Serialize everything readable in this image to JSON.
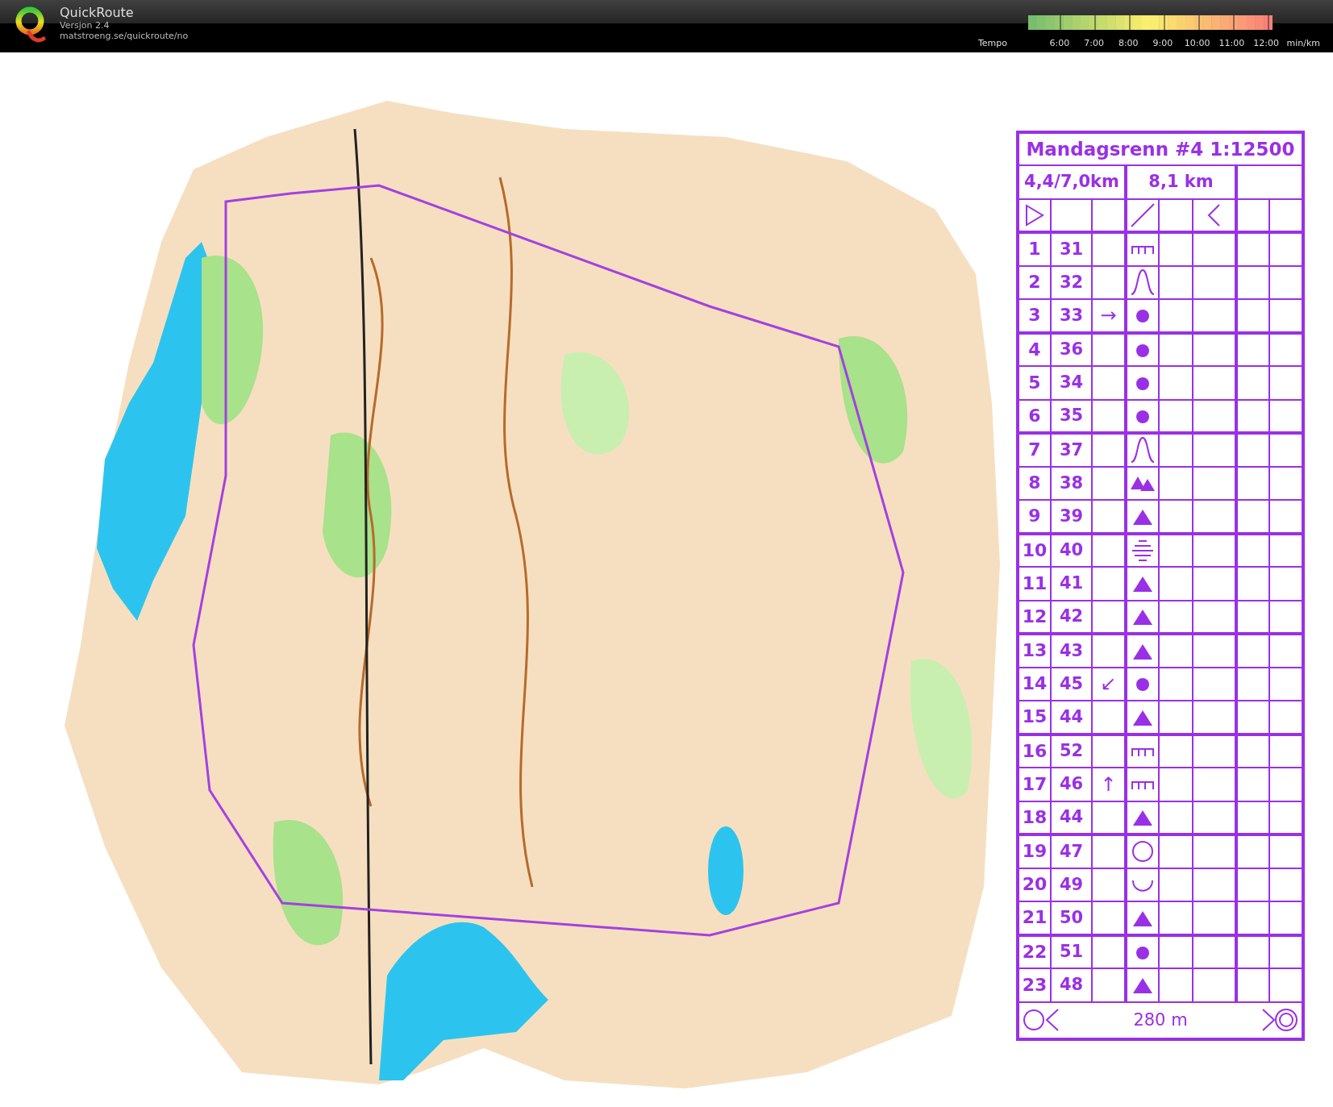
{
  "app": {
    "name": "QuickRoute",
    "version": "Versjon 2.4",
    "url": "matstroeng.se/quickroute/no"
  },
  "tempo_legend": {
    "label": "Tempo",
    "ticks": [
      "6:00",
      "7:00",
      "8:00",
      "9:00",
      "10:00",
      "11:00",
      "12:00"
    ],
    "unit": "min/km"
  },
  "control_sheet": {
    "title": "Mandagsrenn #4 1:12500",
    "climb_info": "4,4/7,0km",
    "length": "8,1 km",
    "controls": [
      {
        "number": "1",
        "code": "31",
        "kind": "cliff"
      },
      {
        "number": "2",
        "code": "32",
        "kind": "spur"
      },
      {
        "number": "3",
        "code": "33",
        "direction": "→",
        "kind": "knoll"
      },
      {
        "number": "4",
        "code": "36",
        "kind": "knoll"
      },
      {
        "number": "5",
        "code": "34",
        "kind": "knoll"
      },
      {
        "number": "6",
        "code": "35",
        "kind": "knoll"
      },
      {
        "number": "7",
        "code": "37",
        "kind": "spur"
      },
      {
        "number": "8",
        "code": "38",
        "kind": "cluster"
      },
      {
        "number": "9",
        "code": "39",
        "kind": "boulder"
      },
      {
        "number": "10",
        "code": "40",
        "kind": "marsh"
      },
      {
        "number": "11",
        "code": "41",
        "kind": "boulder"
      },
      {
        "number": "12",
        "code": "42",
        "kind": "boulder"
      },
      {
        "number": "13",
        "code": "43",
        "kind": "boulder"
      },
      {
        "number": "14",
        "code": "45",
        "direction": "↙",
        "kind": "knoll"
      },
      {
        "number": "15",
        "code": "44",
        "kind": "boulder"
      },
      {
        "number": "16",
        "code": "52",
        "kind": "cliff"
      },
      {
        "number": "17",
        "code": "46",
        "direction": "↑",
        "kind": "cliff"
      },
      {
        "number": "18",
        "code": "44",
        "kind": "boulder"
      },
      {
        "number": "19",
        "code": "47",
        "kind": "ring"
      },
      {
        "number": "20",
        "code": "49",
        "kind": "depression"
      },
      {
        "number": "21",
        "code": "50",
        "kind": "boulder"
      },
      {
        "number": "22",
        "code": "51",
        "kind": "knoll"
      },
      {
        "number": "23",
        "code": "48",
        "kind": "boulder"
      }
    ],
    "finish_distance": "280 m"
  }
}
